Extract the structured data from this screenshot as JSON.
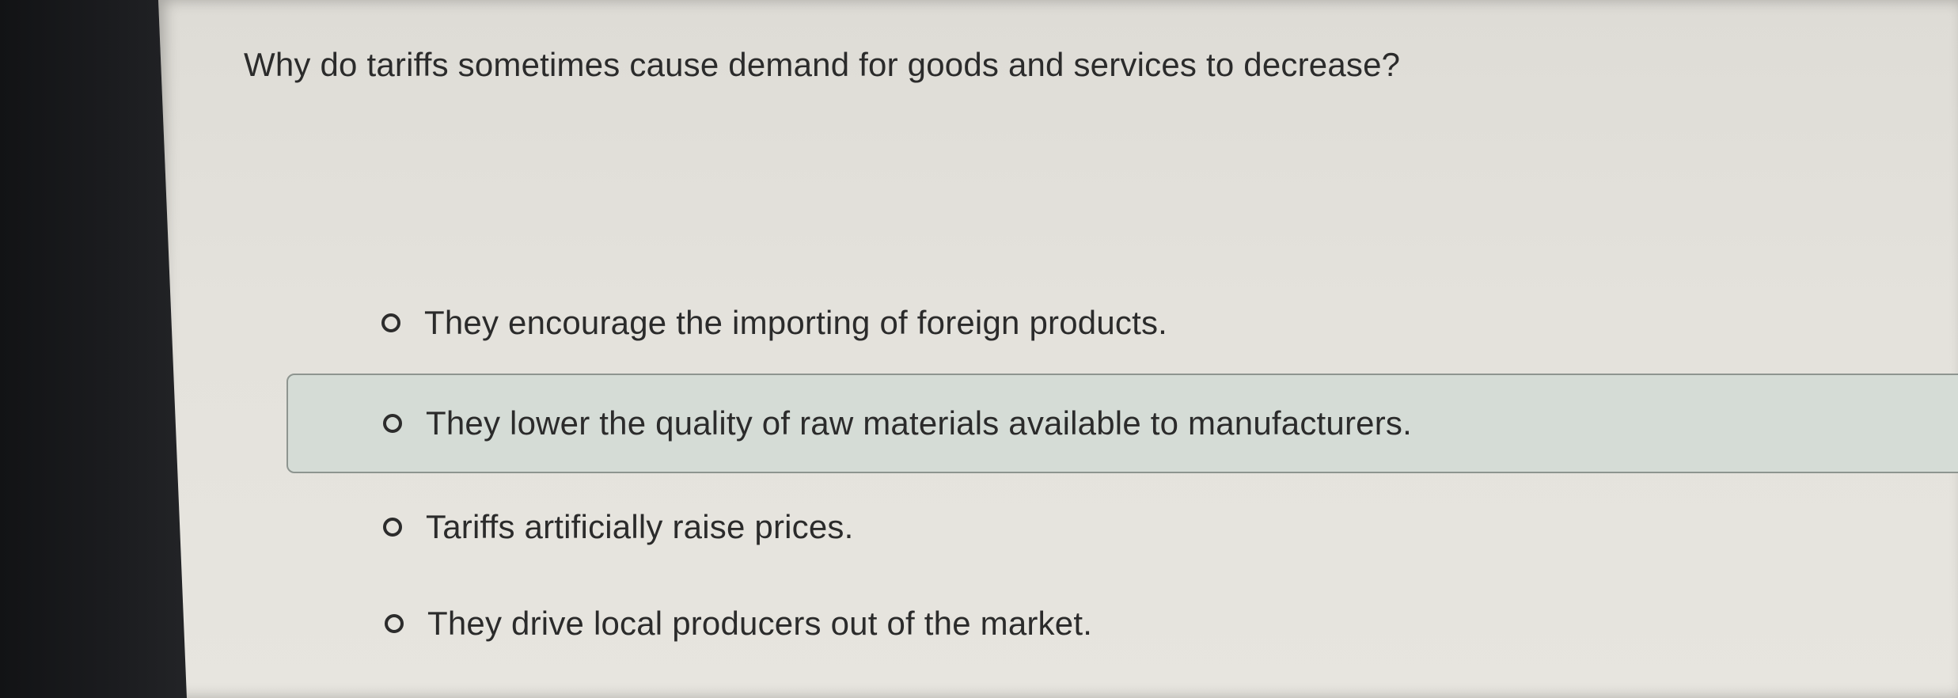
{
  "question": {
    "text": "Why do tariffs sometimes cause demand for goods and services to decrease?"
  },
  "options": [
    {
      "label": "They encourage the importing of foreign products.",
      "selected": false,
      "hovered": false
    },
    {
      "label": "They lower the quality of raw materials available to manufacturers.",
      "selected": false,
      "hovered": true
    },
    {
      "label": "Tariffs artificially raise prices.",
      "selected": false,
      "hovered": false
    },
    {
      "label": "They drive local producers out of the market.",
      "selected": false,
      "hovered": false
    }
  ],
  "colors": {
    "page_background": "#e4e2dc",
    "hover_background": "#d5dcd6",
    "text": "#2b2b2b",
    "bezel": "#1a1b1d"
  }
}
